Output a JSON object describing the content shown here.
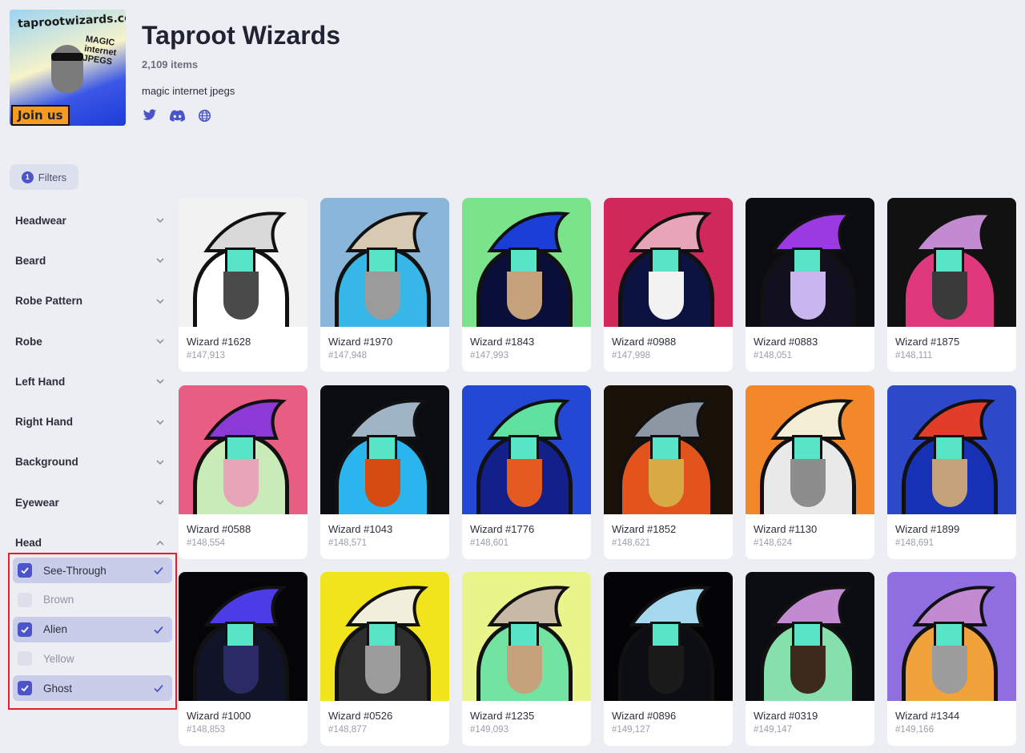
{
  "collection": {
    "title": "Taproot Wizards",
    "item_count": "2,109 items",
    "description": "magic internet jpegs",
    "logo": {
      "top_text": "taprootwizards.com",
      "side_text": "MAGIC internet JPEGS",
      "join_text": "Join us"
    },
    "socials": [
      "twitter-icon",
      "discord-icon",
      "globe-icon"
    ]
  },
  "filters_button": {
    "count": "1",
    "label": "Filters"
  },
  "facets": [
    "Headwear",
    "Beard",
    "Robe Pattern",
    "Robe",
    "Left Hand",
    "Right Hand",
    "Background",
    "Eyewear",
    "Head"
  ],
  "head_options": [
    {
      "label": "See-Through",
      "checked": true
    },
    {
      "label": "Brown",
      "checked": false
    },
    {
      "label": "Alien",
      "checked": true
    },
    {
      "label": "Yellow",
      "checked": false
    },
    {
      "label": "Ghost",
      "checked": true
    }
  ],
  "items": [
    {
      "name": "Wizard #1628",
      "inscription": "#147,913",
      "bg": "#f2f2f2",
      "robe": "#ffffff",
      "hat": "#d9d9d9",
      "beard": "#4a4a4a"
    },
    {
      "name": "Wizard #1970",
      "inscription": "#147,948",
      "bg": "#8ab6d9",
      "robe": "#37b7e8",
      "hat": "#d8c9b3",
      "beard": "#9b9b9b"
    },
    {
      "name": "Wizard #1843",
      "inscription": "#147,993",
      "bg": "#7be38a",
      "robe": "#0a0f3a",
      "hat": "#1b3fd6",
      "beard": "#c6a27a"
    },
    {
      "name": "Wizard #0988",
      "inscription": "#147,998",
      "bg": "#d1285b",
      "robe": "#0d1340",
      "hat": "#e7a6b8",
      "beard": "#f2f2f2"
    },
    {
      "name": "Wizard #0883",
      "inscription": "#148,051",
      "bg": "#0b0b12",
      "robe": "#12101f",
      "hat": "#9a3ae0",
      "beard": "#c9b6ee"
    },
    {
      "name": "Wizard #1875",
      "inscription": "#148,111",
      "bg": "#111111",
      "robe": "#e0387c",
      "hat": "#c28ad1",
      "beard": "#3a3a3a"
    },
    {
      "name": "Wizard #0588",
      "inscription": "#148,554",
      "bg": "#e85d82",
      "robe": "#c8ebb8",
      "hat": "#8c3ad6",
      "beard": "#e7a6b8"
    },
    {
      "name": "Wizard #1043",
      "inscription": "#148,571",
      "bg": "#0b0b12",
      "robe": "#2ab5ee",
      "hat": "#9fb5c6",
      "beard": "#d44c12"
    },
    {
      "name": "Wizard #1776",
      "inscription": "#148,601",
      "bg": "#2348d4",
      "robe": "#14208a",
      "hat": "#5fe2a0",
      "beard": "#e35b1e"
    },
    {
      "name": "Wizard #1852",
      "inscription": "#148,621",
      "bg": "#1a1208",
      "robe": "#e3541c",
      "hat": "#8d97a3",
      "beard": "#d7aa43"
    },
    {
      "name": "Wizard #1130",
      "inscription": "#148,624",
      "bg": "#f2882a",
      "robe": "#e9e9e9",
      "hat": "#f3efd7",
      "beard": "#8d8d8d"
    },
    {
      "name": "Wizard #1899",
      "inscription": "#148,691",
      "bg": "#2d48c9",
      "robe": "#1631b4",
      "hat": "#e23c2b",
      "beard": "#c6a27a"
    },
    {
      "name": "Wizard #1000",
      "inscription": "#148,853",
      "bg": "#050508",
      "robe": "#111326",
      "hat": "#4b3ce6",
      "beard": "#2a2a66"
    },
    {
      "name": "Wizard #0526",
      "inscription": "#148,877",
      "bg": "#f1e41c",
      "robe": "#2d2d2d",
      "hat": "#f2eedc",
      "beard": "#9c9c9c"
    },
    {
      "name": "Wizard #1235",
      "inscription": "#149,093",
      "bg": "#e9f48a",
      "robe": "#72e3a0",
      "hat": "#c8b9a7",
      "beard": "#c6a27a"
    },
    {
      "name": "Wizard #0896",
      "inscription": "#149,127",
      "bg": "#040406",
      "robe": "#0d0d14",
      "hat": "#a5d7ef",
      "beard": "#1a1a1a"
    },
    {
      "name": "Wizard #0319",
      "inscription": "#149,147",
      "bg": "#0b0b12",
      "robe": "#86e0ab",
      "hat": "#c28ad1",
      "beard": "#3d2a1a"
    },
    {
      "name": "Wizard #1344",
      "inscription": "#149,166",
      "bg": "#8f6fe0",
      "robe": "#f2a23a",
      "hat": "#c28ad1",
      "beard": "#9c9c9c"
    }
  ],
  "accent_color": "#4b55c9"
}
